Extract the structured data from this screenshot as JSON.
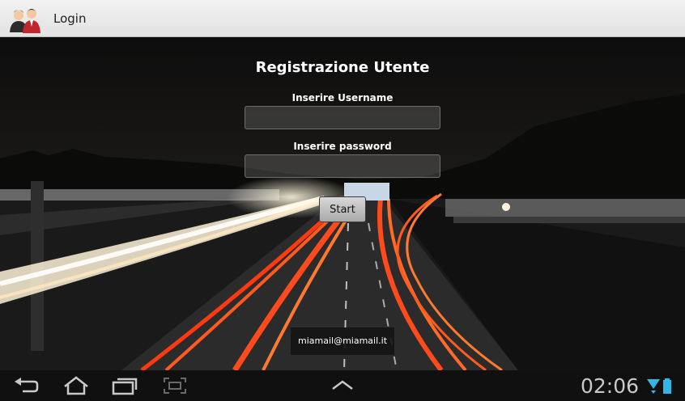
{
  "app": {
    "title": "Login",
    "icon": "users-icon"
  },
  "form": {
    "heading": "Registrazione Utente",
    "username_label": "Inserire Username",
    "username_value": "",
    "password_label": "Inserire password",
    "password_value": "",
    "start_label": "Start"
  },
  "toast": {
    "text": "miamail@miamail.it"
  },
  "navbar": {
    "buttons": [
      "back-icon",
      "home-icon",
      "recent-apps-icon",
      "screenshot-icon",
      "chevron-up-icon"
    ],
    "clock": "02:06",
    "status_icons": [
      "wifi-icon",
      "battery-icon"
    ]
  },
  "colors": {
    "titlebar": "#e8e8e8",
    "trail_red": "#ff4a1e",
    "trail_white": "#fff3d8",
    "status_blue": "#33b5e5",
    "navbar": "#101010"
  }
}
